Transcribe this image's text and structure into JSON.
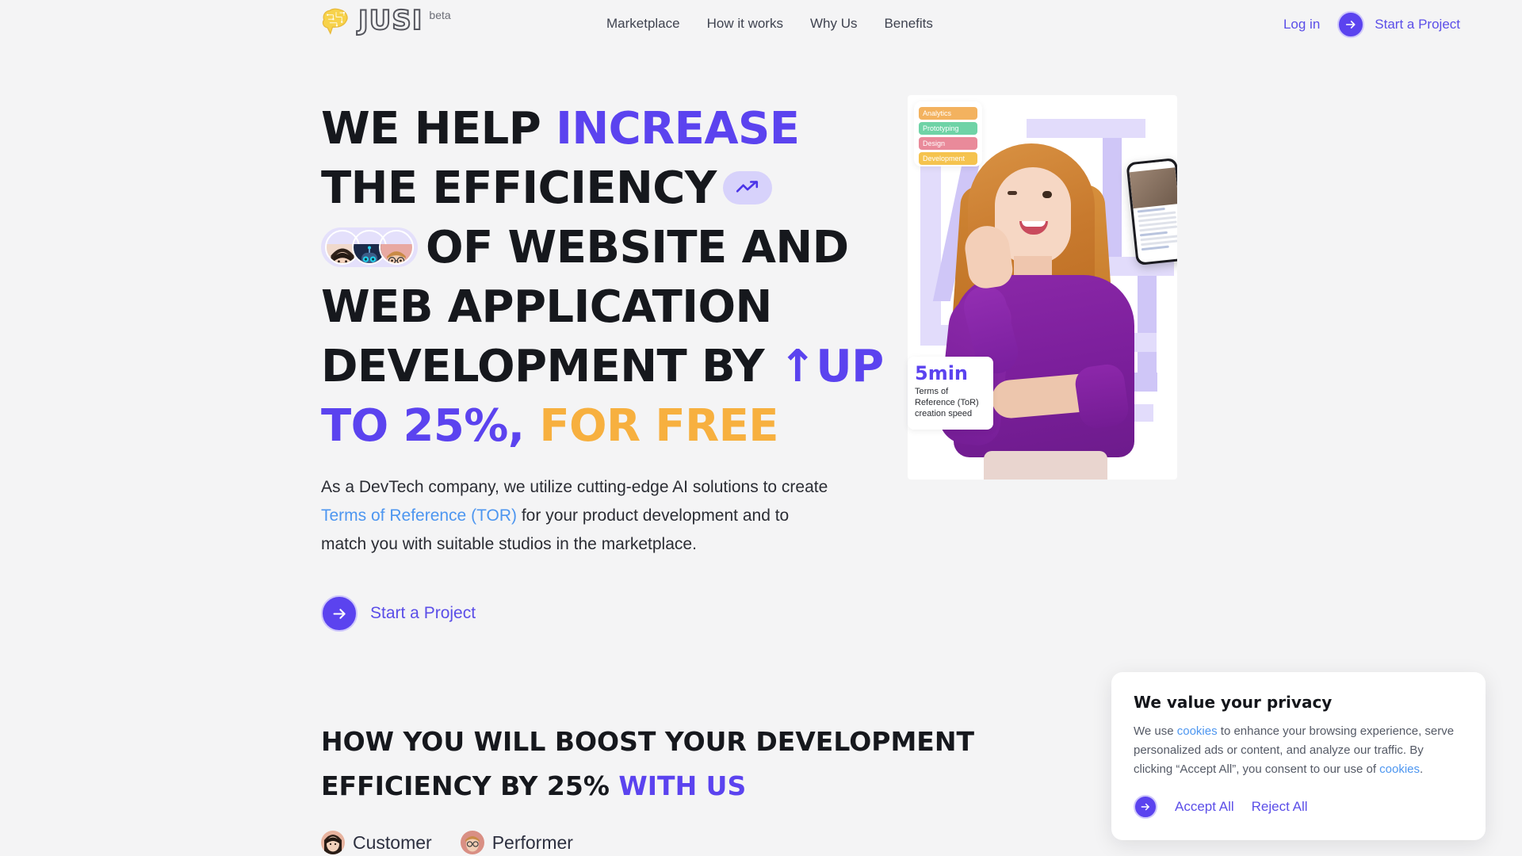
{
  "brand": {
    "logo_text": "JUSI",
    "logo_icon": "brain-icon",
    "beta_label": "beta"
  },
  "nav": {
    "items": [
      {
        "label": "Marketplace"
      },
      {
        "label": "How it works"
      },
      {
        "label": "Why Us"
      },
      {
        "label": "Benefits"
      }
    ],
    "login_label": "Log in",
    "start_project_label": "Start a Project"
  },
  "hero": {
    "headline": {
      "line1_a": "WE HELP ",
      "line1_b": "INCREASE",
      "line2": "THE EFFICIENCY",
      "line2_icon": "trending-up-icon",
      "line3": "OF WEBSITE AND",
      "line4": "WEB APPLICATION",
      "line5_a": "DEVELOPMENT BY ",
      "line5_b": "↑UP",
      "line6_a": "TO 25%",
      "line6_comma": ",",
      "line6_b": "FOR FREE"
    },
    "subtext": {
      "part1": "As a DevTech company, we utilize cutting-edge AI solutions to create ",
      "link": "Terms of Reference (TOR)",
      "part2": " for your product development and to match you with suitable studios in the marketplace."
    },
    "cta_label": "Start a Project",
    "avatars": [
      "woman-avatar",
      "robot-avatar",
      "man-avatar"
    ]
  },
  "hero_art": {
    "tags": [
      {
        "label": "Analytics",
        "color": "#f3b25f"
      },
      {
        "label": "Prototyping",
        "color": "#6fd3a6"
      },
      {
        "label": "Design",
        "color": "#e98a9a"
      },
      {
        "label": "Development",
        "color": "#f5c34e"
      }
    ],
    "speed_card": {
      "value": "5min",
      "description": "Terms of\nReference (ToR)\ncreation speed"
    }
  },
  "section2": {
    "title_a": "HOW YOU WILL BOOST YOUR DEVELOPMENT EFFICIENCY BY 25% ",
    "title_b": "WITH US",
    "tabs": [
      {
        "label": "Customer"
      },
      {
        "label": "Performer"
      }
    ]
  },
  "cookie": {
    "title": "We value your privacy",
    "body_part1": "We use ",
    "body_link1": "cookies",
    "body_part2": " to enhance your browsing experience, serve personalized ads or content, and analyze our traffic. By clicking “Accept All”, you consent to our use of ",
    "body_link2": "cookies",
    "body_part3": ".",
    "accept_label": "Accept All",
    "reject_label": "Reject All"
  },
  "colors": {
    "background": "#f4f4f5",
    "purple": "#5b43ef",
    "purple_link": "#5b4ee8",
    "amber": "#f7b03f",
    "blue_link": "#4d96f0",
    "text_dark": "#16181d"
  }
}
